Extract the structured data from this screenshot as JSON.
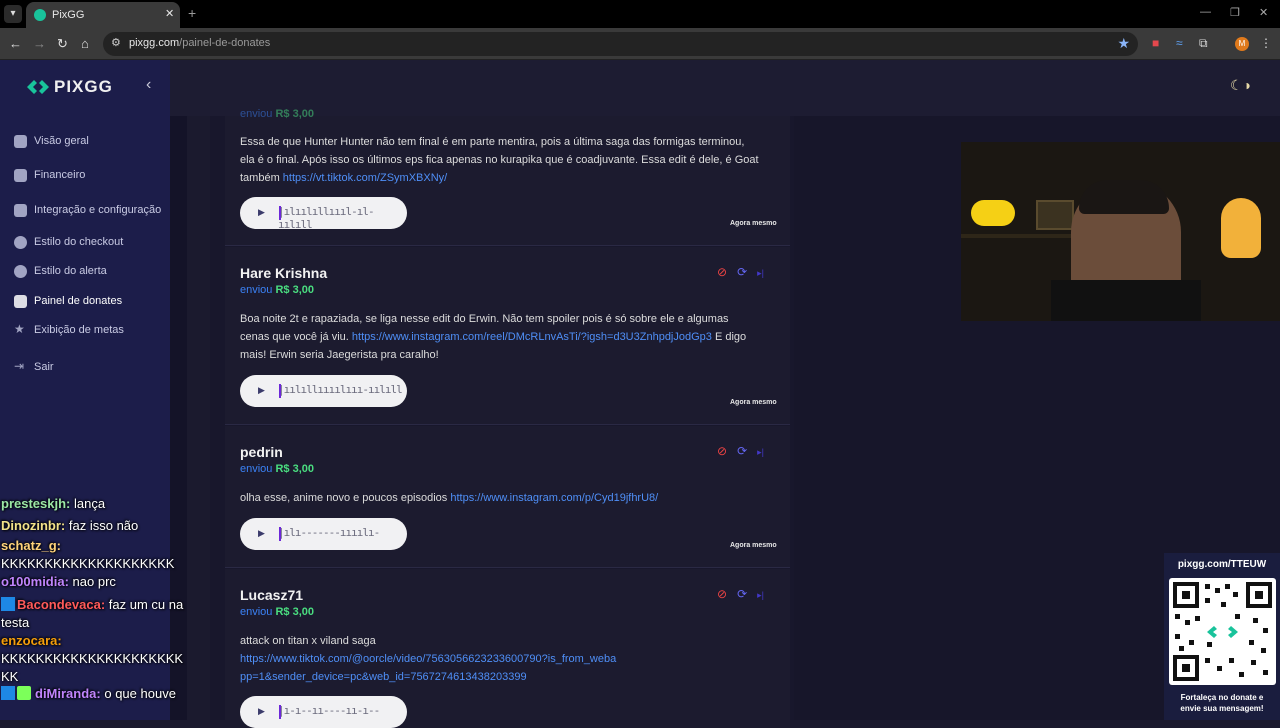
{
  "browser": {
    "tab_title": "PixGG",
    "url_domain": "pixgg.com",
    "url_path": "/painel-de-donates",
    "new_tab": "+",
    "profile_initial": "M"
  },
  "sidebar": {
    "logo": "PIXGG",
    "items": [
      {
        "label": "Visão geral",
        "icon": "home-icon"
      },
      {
        "label": "Financeiro",
        "icon": "wallet-icon"
      },
      {
        "label": "Integração e configuração",
        "icon": "doc-icon"
      },
      {
        "label": "Estilo do checkout",
        "icon": "palette-icon"
      },
      {
        "label": "Estilo do alerta",
        "icon": "palette-icon"
      },
      {
        "label": "Painel de donates",
        "icon": "hand-coin-icon"
      },
      {
        "label": "Exibição de metas",
        "icon": "star-icon"
      },
      {
        "label": "Sair",
        "icon": "logout-icon"
      }
    ]
  },
  "donations": [
    {
      "sent_prefix": "enviou",
      "amount": "R$ 3,00",
      "message_text": "Essa de que Hunter Hunter não tem final é em parte mentira, pois a última saga das formigas terminou, ela é o final. Após isso os últimos eps fica apenas no kurapika que é coadjuvante. Essa edit é dele, é Goat também ",
      "link": "https://vt.tiktok.com/ZSymXBXNy/",
      "message_after": "",
      "time": "Agora mesmo"
    },
    {
      "name": "Hare Krishna",
      "sent_prefix": "enviou",
      "amount": "R$ 3,00",
      "message_text": "Boa noite 2t e rapaziada, se liga nesse edit do Erwin. Não tem spoiler pois é só sobre ele e algumas cenas que você já viu. ",
      "link": "https://www.instagram.com/reel/DMcRLnvAsTi/?igsh=d3U3ZnhpdjJodGp3",
      "message_after": " E digo mais! Erwin seria Jaegerista pra caralho!",
      "time": "Agora mesmo"
    },
    {
      "name": "pedrin",
      "sent_prefix": "enviou",
      "amount": "R$ 3,00",
      "message_text": "olha esse, anime novo e poucos episodios ",
      "link": "https://www.instagram.com/p/Cyd19jfhrU8/",
      "message_after": "",
      "time": "Agora mesmo"
    },
    {
      "name": "Lucasz71",
      "sent_prefix": "enviou",
      "amount": "R$ 3,00",
      "message_text": "attack on titan x viland saga",
      "link": "https://www.tiktok.com/@oorcle/video/7563056623233600790?is_from_webapp=1&sender_device=pc&web_id=7567274613438203399",
      "message_after": "",
      "time": ""
    }
  ],
  "chat": [
    {
      "user": "presteskjh:",
      "text": "lança",
      "color": "#9be7a5"
    },
    {
      "user": "Dinozinbr:",
      "text": "faz isso não",
      "color": "#f3e28a"
    },
    {
      "user": "schatz_g:",
      "text": "KKKKKKKKKKKKKKKKKKKK",
      "color": "#ffd37a"
    },
    {
      "user": "o100midia:",
      "text": "nao prc",
      "color": "#c084fc"
    },
    {
      "user": "Bacondevaca:",
      "text": "faz um cu na testa",
      "color": "#ff5a5a"
    },
    {
      "user": "enzocara:",
      "text": "KKKKKKKKKKKKKKKKKKKKKKK",
      "color": "#f59e0b"
    },
    {
      "user": "diMiranda:",
      "text": "o que houve",
      "color": "#c084fc"
    }
  ],
  "qr_widget": {
    "url": "pixgg.com/TTEUW",
    "caption_1": "Fortaleça no donate e",
    "caption_2": "envie sua mensagem!"
  },
  "player": {
    "wave_1": "|ılıılıllıııl-ıl-ıılıll",
    "wave_2": "|ıılıllıııılııı-ıılıll",
    "wave_3": "|ılı-------ıııılı-",
    "wave_4": "|ı-ı--ıı----ıı-ı--"
  }
}
